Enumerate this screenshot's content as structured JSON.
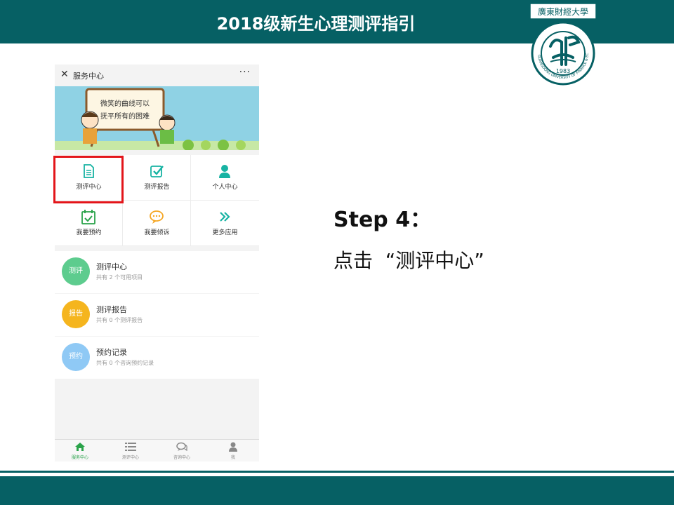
{
  "slide": {
    "title": "2018级新生心理测评指引",
    "logo": {
      "text_top": "廣東財經大學",
      "text_left": "GUANGDONG UNIVERSITY OF FINANCE & ECONOMICS",
      "year": "1983"
    },
    "step_title": "Step 4：",
    "step_desc": "点击  “测评中心”"
  },
  "colors": {
    "teal": "#066064",
    "highlight_red": "#e3151a",
    "icon_teal": "#17b3a3",
    "icon_green": "#2aa34a",
    "icon_orange": "#f5a623"
  },
  "phone": {
    "titlebar": {
      "close_icon": "close-icon",
      "title": "服务中心",
      "more_icon": "more-icon"
    },
    "banner": {
      "line1": "微笑的曲线可以",
      "line2": "抚平所有的困难"
    },
    "grid": [
      {
        "label": "测评中心",
        "icon": "document-icon",
        "color": "#17b3a3"
      },
      {
        "label": "测评报告",
        "icon": "checkbox-icon",
        "color": "#17b3a3"
      },
      {
        "label": "个人中心",
        "icon": "person-icon",
        "color": "#17b3a3"
      },
      {
        "label": "我要预约",
        "icon": "calendar-check-icon",
        "color": "#2aa34a"
      },
      {
        "label": "我要倾诉",
        "icon": "chat-bubble-icon",
        "color": "#f5a623"
      },
      {
        "label": "更多应用",
        "icon": "double-chevron-icon",
        "color": "#17b3a3"
      }
    ],
    "list": [
      {
        "badge": "测评",
        "badge_color": "#5dcc8e",
        "title": "测评中心",
        "subtitle": "共有 2 个可用项目"
      },
      {
        "badge": "报告",
        "badge_color": "#f5b51e",
        "title": "测评报告",
        "subtitle": "共有 0 个测评报告"
      },
      {
        "badge": "预约",
        "badge_color": "#8fc9f5",
        "title": "预约记录",
        "subtitle": "共有 0 个咨询预约记录"
      }
    ],
    "tabbar": [
      {
        "label": "服务中心",
        "icon": "home-icon",
        "active": true
      },
      {
        "label": "测评中心",
        "icon": "list-icon",
        "active": false
      },
      {
        "label": "咨询中心",
        "icon": "chat-icon",
        "active": false
      },
      {
        "label": "我",
        "icon": "user-icon",
        "active": false
      }
    ]
  }
}
